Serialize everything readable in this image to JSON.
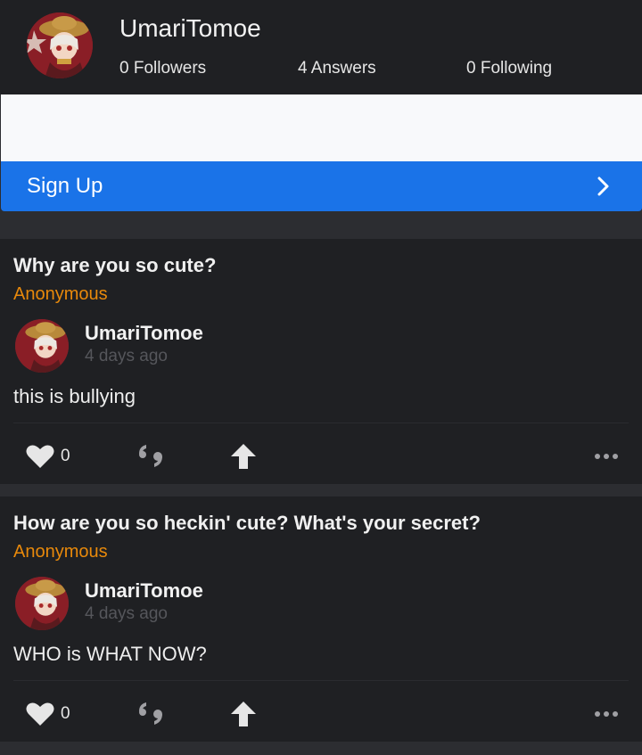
{
  "profile": {
    "name": "UmariTomoe",
    "followers": "0 Followers",
    "answers": "4 Answers",
    "following": "0 Following",
    "avatar_icon": "anime-avatar"
  },
  "signup": {
    "label": "Sign Up",
    "icon": "chevron-right-icon",
    "color": "#1a73e8"
  },
  "colors": {
    "anonymous": "#e8890b",
    "card_bg": "#1f2023",
    "page_bg": "#2c2d31"
  },
  "posts": [
    {
      "question": "Why are you so cute?",
      "asker": "Anonymous",
      "answerer": "UmariTomoe",
      "time": "4 days ago",
      "answer": "this is bullying",
      "likes": "0"
    },
    {
      "question": "How are you so heckin' cute? What's your secret?",
      "asker": "Anonymous",
      "answerer": "UmariTomoe",
      "time": "4 days ago",
      "answer": "WHO is WHAT NOW?",
      "likes": "0"
    }
  ]
}
